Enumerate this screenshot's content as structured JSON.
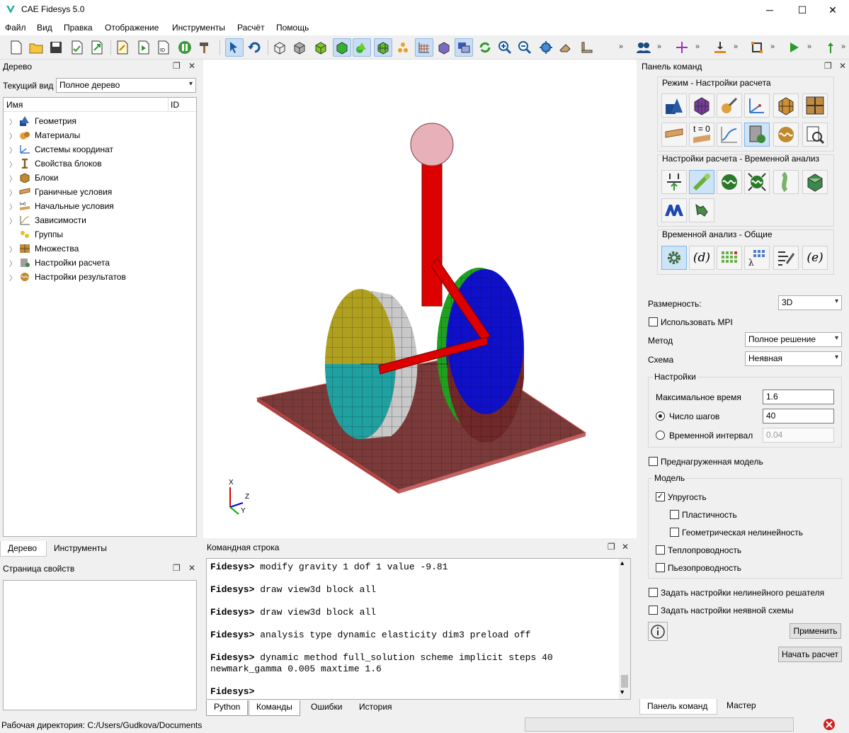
{
  "window": {
    "title": "CAE Fidesys 5.0",
    "minimize": "─",
    "maximize": "☐",
    "close": "✕"
  },
  "menu": [
    "Файл",
    "Вид",
    "Правка",
    "Отображение",
    "Инструменты",
    "Расчёт",
    "Помощь"
  ],
  "tree_panel": {
    "title": "Дерево",
    "current_view_label": "Текущий вид",
    "current_view_value": "Полное дерево",
    "col_name": "Имя",
    "col_id": "ID",
    "items": [
      "Геометрия",
      "Материалы",
      "Системы координат",
      "Свойства блоков",
      "Блоки",
      "Граничные условия",
      "Начальные условия",
      "Зависимости",
      "Группы",
      "Множества",
      "Настройки расчета",
      "Настройки результатов"
    ],
    "tabs": [
      "Дерево",
      "Инструменты"
    ]
  },
  "properties_panel": {
    "title": "Страница свойств"
  },
  "viewport": {
    "axis_x": "X",
    "axis_y": "Y",
    "axis_z": "Z"
  },
  "console_panel": {
    "title": "Командная строка",
    "prompt": "Fidesys>",
    "lines": [
      {
        "prompt": "Fidesys>",
        "cmd": " modify gravity 1 dof 1 value -9.81"
      },
      {
        "prompt": "Fidesys>",
        "cmd": " draw view3d block all"
      },
      {
        "prompt": "Fidesys>",
        "cmd": " draw view3d block all"
      },
      {
        "prompt": "Fidesys>",
        "cmd": " analysis type dynamic elasticity dim3 preload off"
      },
      {
        "prompt": "Fidesys>",
        "cmd": " dynamic method full_solution scheme implicit steps 40"
      },
      {
        "prompt": "",
        "cmd": "newmark_gamma 0.005 maxtime 1.6"
      },
      {
        "prompt": "Fidesys>",
        "cmd": ""
      }
    ],
    "tabs": [
      "Python",
      "Команды",
      "Ошибки",
      "История"
    ]
  },
  "command_panel": {
    "title": "Панель команд",
    "mode_group": "Режим - Настройки расчета",
    "t0_label": "t = 0",
    "analysis_group": "Настройки расчета - Временной анализ",
    "general_group": "Временной анализ - Общие",
    "d_label": "(d)",
    "e_label": "(e)",
    "dimension_label": "Размерность:",
    "dimension_value": "3D",
    "mpi_label": "Использовать MPI",
    "method_label": "Метод",
    "method_value": "Полное решение",
    "scheme_label": "Схема",
    "scheme_value": "Неявная",
    "settings_group": "Настройки",
    "max_time_label": "Максимальное время",
    "max_time_value": "1.6",
    "steps_label": "Число шагов",
    "steps_value": "40",
    "interval_label": "Временной интервал",
    "interval_value": "0.04",
    "preloaded_label": "Преднагруженная модель",
    "model_group": "Модель",
    "elasticity_label": "Упругость",
    "plasticity_label": "Пластичность",
    "geom_nonlin_label": "Геометрическая нелинейность",
    "thermal_label": "Теплопроводность",
    "piezo_label": "Пьезопроводность",
    "nonlin_solver_label": "Задать настройки нелинейного решателя",
    "implicit_scheme_label": "Задать настройки неявной схемы",
    "apply_button": "Применить",
    "start_button": "Начать расчет",
    "tabs": [
      "Панель команд",
      "Мастер"
    ]
  },
  "status": {
    "workdir": "Рабочая директория: C:/Users/Gudkova/Documents"
  }
}
